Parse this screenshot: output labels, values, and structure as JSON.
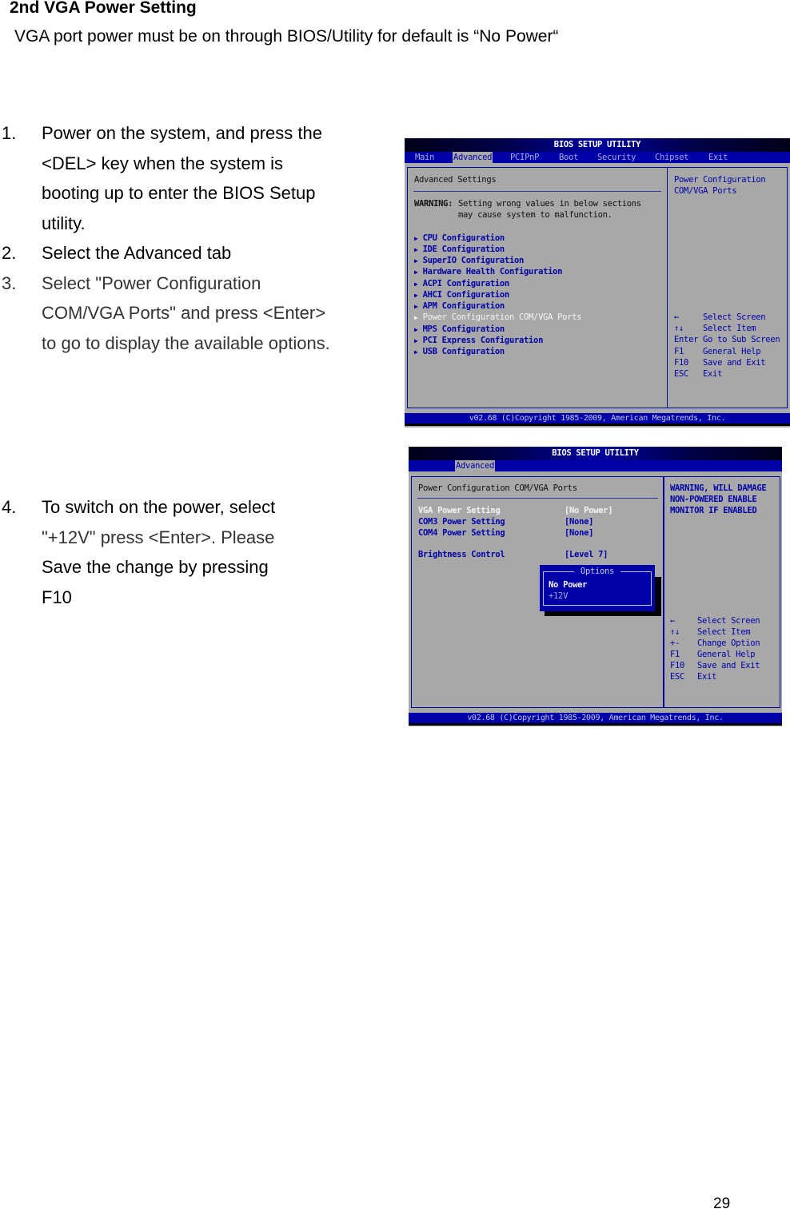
{
  "document": {
    "title": "2nd VGA Power Setting",
    "subtitle": "VGA port power must be on through BIOS/Utility for default is “No Power“",
    "page_number": "29",
    "steps_part1": [
      {
        "num": "1.",
        "lines": [
          "Power on the system, and press the",
          "<DEL> key when the system is",
          "booting up to enter the BIOS Setup",
          "utility."
        ]
      },
      {
        "num": "2.",
        "lines": [
          "Select the Advanced tab"
        ]
      },
      {
        "num": "3.",
        "lines": [
          "Select \"Power Configuration",
          "COM/VGA Ports\" and press <Enter>",
          "to go to display the available options."
        ]
      }
    ],
    "steps_part2": [
      {
        "num": "4.",
        "lines": [
          "To switch on the power, select",
          "\"+12V\" press <Enter>. Please",
          "Save the change by pressing",
          "F10"
        ]
      }
    ]
  },
  "bios1": {
    "title": "BIOS SETUP UTILITY",
    "tabs": [
      "Main",
      "Advanced",
      "PCIPnP",
      "Boot",
      "Security",
      "Chipset",
      "Exit"
    ],
    "active_tab": "Advanced",
    "section_title": "Advanced Settings",
    "warning_label": "WARNING:",
    "warning_line1": "Setting wrong values in below sections",
    "warning_line2": "may cause system to malfunction.",
    "menu_items": [
      "CPU Configuration",
      "IDE Configuration",
      "SuperIO Configuration",
      "Hardware Health Configuration",
      "ACPI Configuration",
      "AHCI Configuration",
      "APM Configuration",
      "Power Configuration COM/VGA Ports",
      "MPS Configuration",
      "PCI Express Configuration",
      "USB Configuration"
    ],
    "selected_item": "Power Configuration COM/VGA Ports",
    "help_text": [
      "Power Configuration",
      "COM/VGA Ports"
    ],
    "keys": [
      {
        "key": "←",
        "action": "Select Screen"
      },
      {
        "key": "↑↓",
        "action": "Select Item"
      },
      {
        "key": "Enter",
        "action": "Go to Sub Screen"
      },
      {
        "key": "F1",
        "action": "General Help"
      },
      {
        "key": "F10",
        "action": "Save and Exit"
      },
      {
        "key": "ESC",
        "action": "Exit"
      }
    ],
    "footer": "v02.68 (C)Copyright 1985-2009, American Megatrends, Inc."
  },
  "bios2": {
    "title": "BIOS SETUP UTILITY",
    "active_tab": "Advanced",
    "section_title": "Power Configuration COM/VGA Ports",
    "settings": [
      {
        "label": "VGA Power Setting",
        "value": "[No Power]",
        "selected": true
      },
      {
        "label": "COM3 Power Setting",
        "value": "[None]"
      },
      {
        "label": "COM4 Power Setting",
        "value": "[None]"
      },
      {
        "label": "Brightness Control",
        "value": "[Level 7]"
      }
    ],
    "help_text": [
      "WARNING, WILL DAMAGE",
      "NON-POWERED ENABLE",
      "MONITOR IF ENABLED"
    ],
    "options_popup": {
      "title": "Options",
      "options": [
        "No Power",
        "+12V"
      ],
      "highlighted": "No Power"
    },
    "keys": [
      {
        "key": "←",
        "action": "Select Screen"
      },
      {
        "key": "↑↓",
        "action": "Select Item"
      },
      {
        "key": "+-",
        "action": "Change Option"
      },
      {
        "key": "F1",
        "action": "General Help"
      },
      {
        "key": "F10",
        "action": "Save and Exit"
      },
      {
        "key": "ESC",
        "action": "Exit"
      }
    ],
    "footer": "v02.68 (C)Copyright 1985-2009, American Megatrends, Inc."
  }
}
